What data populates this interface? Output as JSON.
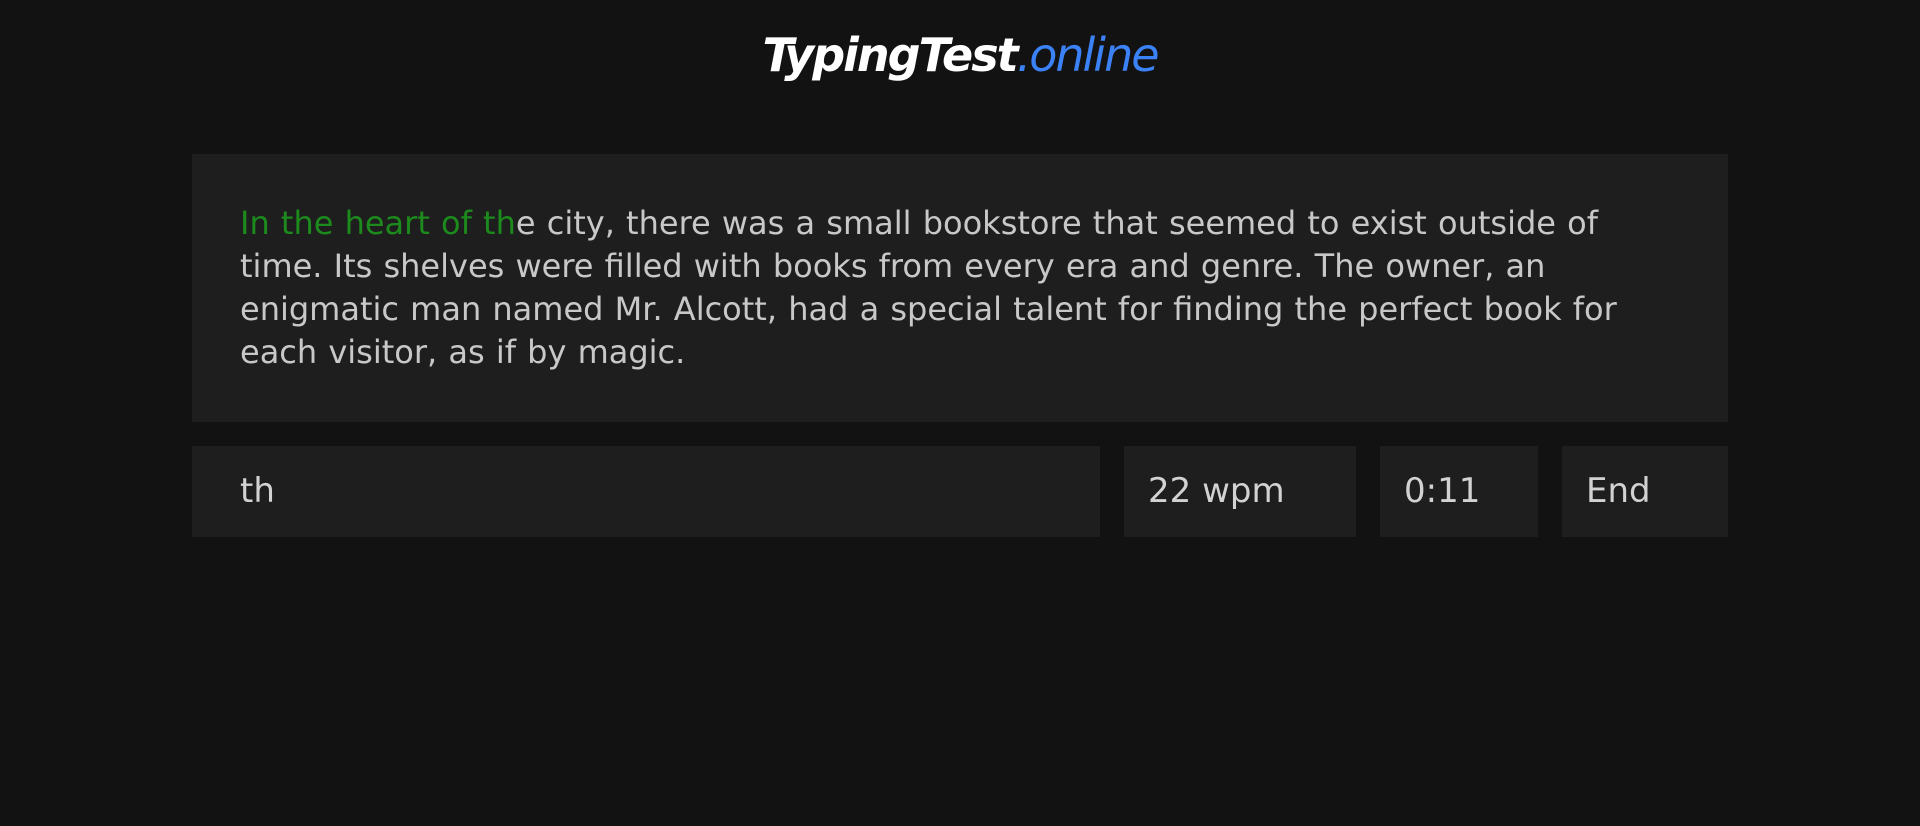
{
  "header": {
    "logo_main": "TypingTest",
    "logo_tld": ".online"
  },
  "passage": {
    "typed": "In the heart of th",
    "remaining": "e city, there was a small bookstore that seemed to exist outside of time. Its shelves were filled with books from every era and genre. The owner, an enigmatic man named Mr. Alcott, had a special talent for finding the perfect book for each visitor, as if by magic."
  },
  "controls": {
    "input_value": "th",
    "wpm": "22 wpm",
    "timer": "0:11",
    "end_label": "End"
  },
  "colors": {
    "background": "#121212",
    "panel": "#1e1e1e",
    "typed_text": "#1c8a1c",
    "accent": "#3b82f6"
  }
}
